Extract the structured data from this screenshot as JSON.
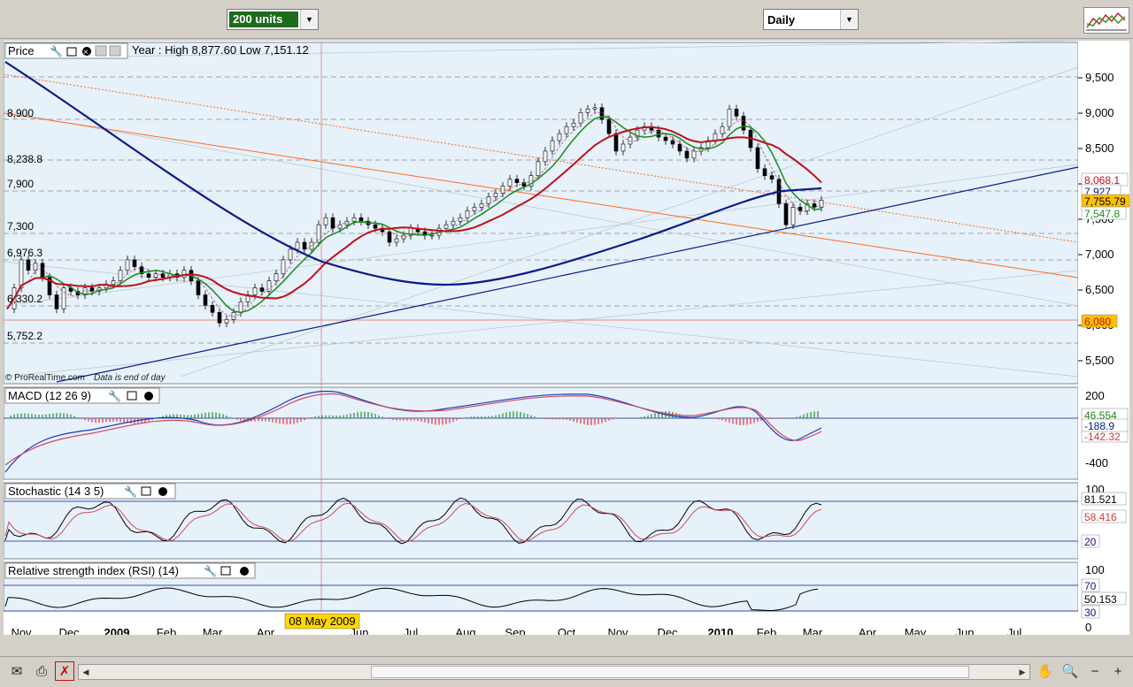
{
  "toolbar": {
    "units_value": "200 units",
    "timeframe_value": "Daily",
    "chart_icon": "candlestick-chart-icon"
  },
  "price_panel": {
    "title": "Price",
    "info": "Year : High 8,877.60 Low 7,151.12",
    "copyright": "© ProRealTime.com",
    "eod_note": "Data is end of day",
    "left_labels": [
      "8,900",
      "8,238.8",
      "7,900",
      "7,300",
      "6,976.3",
      "6,330.2",
      "5,752.2"
    ],
    "axis_ticks": [
      "9,500",
      "9,000",
      "8,500",
      "8,000",
      "7,500",
      "7,000",
      "6,500",
      "6,000",
      "5,500"
    ],
    "value_badges": [
      "8,068.1",
      "7,927",
      "7,755.79",
      "7,547.8",
      "6,080"
    ],
    "colors": {
      "ma_blue": "#0a1a8c",
      "ma_red": "#c0101a",
      "ma_green": "#1a8c1a",
      "trend_orange": "#ff6a1a",
      "bg": "#e6f1fa"
    }
  },
  "macd_panel": {
    "title": "MACD (12 26 9)",
    "axis_ticks": [
      "200",
      "-400"
    ],
    "value_badges": [
      "46.554",
      "-142.32",
      "-188.9"
    ]
  },
  "stochastic_panel": {
    "title": "Stochastic (14 3 5)",
    "axis_ticks": [
      "100"
    ],
    "value_badges": [
      "81.521",
      "58.416",
      "20"
    ]
  },
  "rsi_panel": {
    "title": "Relative strength index (RSI) (14)",
    "axis_ticks": [
      "100",
      "0"
    ],
    "value_badges": [
      "70",
      "50.153",
      "30"
    ]
  },
  "x_axis": {
    "labels": [
      "Nov",
      "Dec",
      "2009",
      "Feb",
      "Mar",
      "Apr",
      "Jun",
      "Jul",
      "Aug",
      "Sep",
      "Oct",
      "Nov",
      "Dec",
      "2010",
      "Feb",
      "Mar",
      "Apr",
      "May",
      "Jun",
      "Jul"
    ],
    "cursor_date": "08 May 2009"
  },
  "statusbar": {
    "icons": [
      "envelope-icon",
      "printer-icon",
      "crosshair-off-icon"
    ],
    "right_icons": [
      "hand-icon",
      "zoom-fit-icon",
      "zoom-out-icon",
      "zoom-in-icon"
    ]
  }
}
